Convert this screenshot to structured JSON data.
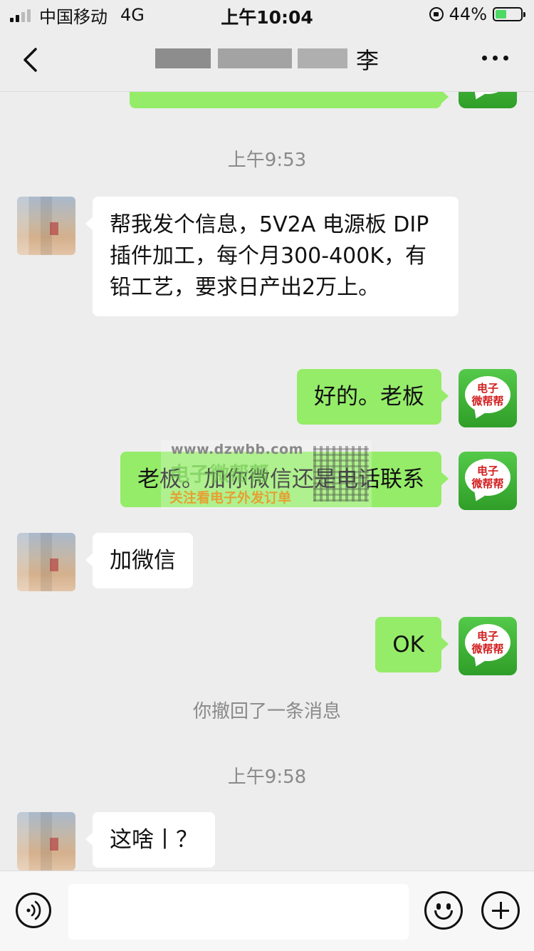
{
  "status_bar": {
    "carrier": "中国移动",
    "network": "4G",
    "time": "上午10:04",
    "battery": "44%",
    "battery_level": 0.44,
    "icons": [
      "signal-icon",
      "rotation-lock-icon",
      "battery-icon"
    ]
  },
  "nav": {
    "title_visible_char": "李",
    "icons": [
      "back-chevron-icon",
      "more-dots-icon"
    ]
  },
  "chat": {
    "timestamp_1": "上午9:53",
    "msg_1": "帮我发个信息，5V2A 电源板 DIP 插件加工，每个月300-400K，有铅工艺，要求日产出2万上。",
    "msg_2": "好的。老板",
    "msg_3": "老板。加你微信还是电话联系",
    "msg_4": "加微信",
    "msg_5": "OK",
    "system_1": "你撤回了一条消息",
    "timestamp_2": "上午9:58",
    "msg_6": "这啥丨？"
  },
  "own_avatar": {
    "line1": "电子",
    "line2": "微帮帮"
  },
  "watermark": {
    "url": "www.dzwbb.com",
    "big": "电子微帮帮",
    "sub": "关注看电子外发订单"
  },
  "input_bar": {
    "placeholder": "",
    "icons": [
      "voice-icon",
      "emoji-icon",
      "plus-icon"
    ]
  },
  "colors": {
    "background": "#ededed",
    "outgoing_bubble": "#95ec69",
    "incoming_bubble": "#ffffff",
    "avatar_green": "#3fb336",
    "avatar_text_red": "#d21f1f"
  }
}
